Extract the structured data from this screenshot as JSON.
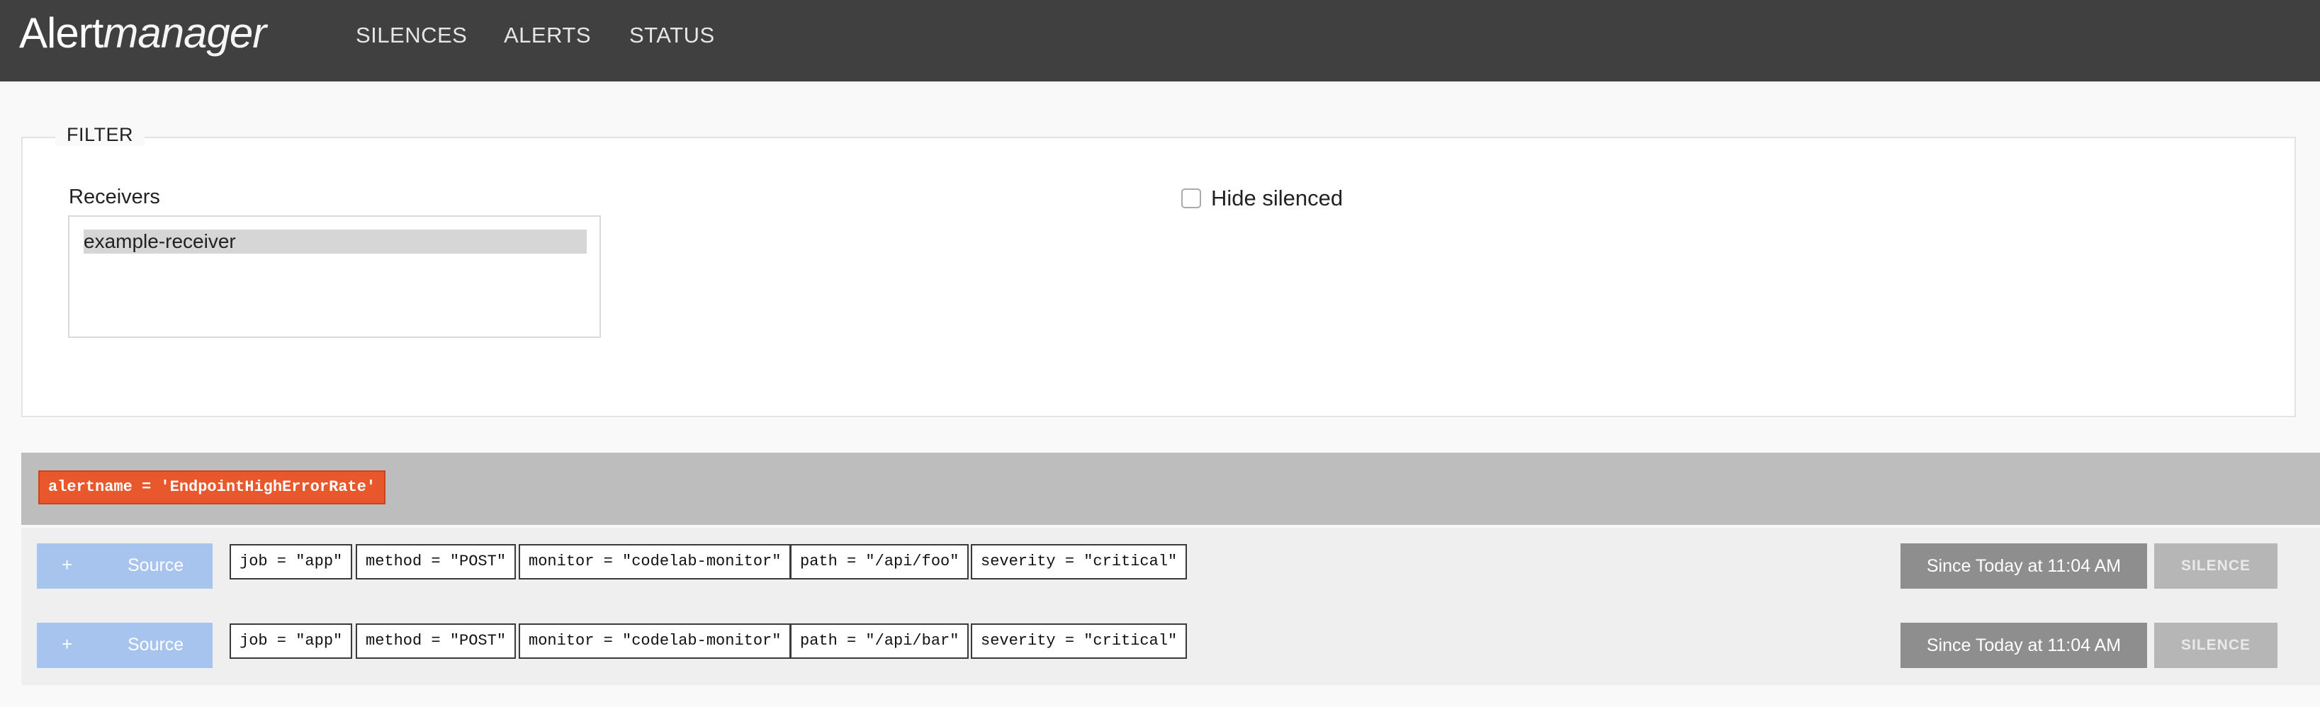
{
  "app": {
    "brand_prefix": "Alert",
    "brand_suffix": "manager"
  },
  "nav": {
    "items": [
      {
        "label": "SILENCES"
      },
      {
        "label": "ALERTS"
      },
      {
        "label": "STATUS"
      }
    ]
  },
  "filter": {
    "legend": "FILTER",
    "receivers_label": "Receivers",
    "receivers": [
      {
        "label": "example-receiver",
        "selected": true
      }
    ],
    "hide_silenced_label": "Hide silenced",
    "hide_silenced_checked": false
  },
  "groups": [
    {
      "badge": "alertname = 'EndpointHighErrorRate'",
      "alerts": [
        {
          "source_plus": "+",
          "source_label": "Source",
          "labels": [
            "job = \"app\"",
            "method = \"POST\"",
            "monitor = \"codelab-monitor\"",
            "path = \"/api/foo\"",
            "severity = \"critical\""
          ],
          "since": "Since Today at 11:04 AM",
          "silence": "SILENCE"
        },
        {
          "source_plus": "+",
          "source_label": "Source",
          "labels": [
            "job = \"app\"",
            "method = \"POST\"",
            "monitor = \"codelab-monitor\"",
            "path = \"/api/bar\"",
            "severity = \"critical\""
          ],
          "since": "Since Today at 11:04 AM",
          "silence": "SILENCE"
        }
      ]
    }
  ],
  "colors": {
    "navbar": "#404040",
    "alert_badge": "#e8582c",
    "source_button": "#a7c4ef",
    "since_button": "#8e8e8e",
    "silence_button": "#b6b6b6"
  }
}
